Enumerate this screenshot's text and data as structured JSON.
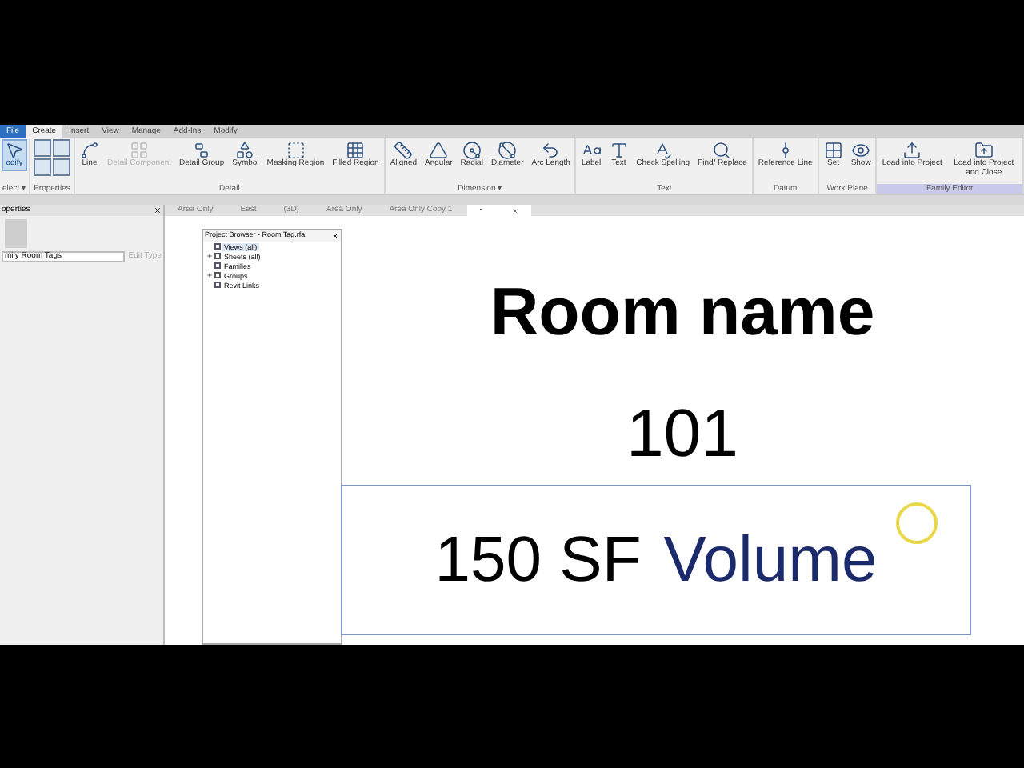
{
  "menu_tabs": [
    {
      "label": "File",
      "kind": "file",
      "selected": false
    },
    {
      "label": "Create",
      "kind": "tab",
      "selected": true
    },
    {
      "label": "Insert",
      "kind": "tab",
      "selected": false
    },
    {
      "label": "View",
      "kind": "tab",
      "selected": false
    },
    {
      "label": "Manage",
      "kind": "tab",
      "selected": false
    },
    {
      "label": "Add-Ins",
      "kind": "tab",
      "selected": false
    },
    {
      "label": "Modify",
      "kind": "tab",
      "selected": false
    }
  ],
  "ribbon_panels": [
    {
      "label": "elect ▾",
      "highlighted": false,
      "tools": [
        {
          "label": "odify",
          "kind": "large",
          "selected": true,
          "disabled": false
        }
      ]
    },
    {
      "label": "Properties",
      "highlighted": false,
      "tools": [
        {
          "kind": "stack"
        }
      ]
    },
    {
      "label": "Detail",
      "highlighted": false,
      "tools": [
        {
          "label": "Line",
          "kind": "large",
          "selected": false,
          "disabled": false
        },
        {
          "label": "Detail Component",
          "kind": "large",
          "selected": false,
          "disabled": true
        },
        {
          "label": "Detail Group",
          "kind": "large",
          "selected": false,
          "disabled": false
        },
        {
          "label": "Symbol",
          "kind": "large",
          "selected": false,
          "disabled": false
        },
        {
          "label": "Masking Region",
          "kind": "large",
          "selected": false,
          "disabled": false
        },
        {
          "label": "Filled Region",
          "kind": "large",
          "selected": false,
          "disabled": false
        }
      ]
    },
    {
      "label": "Dimension ▾",
      "highlighted": false,
      "tools": [
        {
          "label": "Aligned",
          "kind": "large",
          "selected": false,
          "disabled": false
        },
        {
          "label": "Angular",
          "kind": "large",
          "selected": false,
          "disabled": false
        },
        {
          "label": "Radial",
          "kind": "large",
          "selected": false,
          "disabled": false
        },
        {
          "label": "Diameter",
          "kind": "large",
          "selected": false,
          "disabled": false
        },
        {
          "label": "Arc Length",
          "kind": "large",
          "selected": false,
          "disabled": false
        }
      ]
    },
    {
      "label": "Text",
      "highlighted": false,
      "tools": [
        {
          "label": "Label",
          "kind": "large",
          "selected": false,
          "disabled": false
        },
        {
          "label": "Text",
          "kind": "large",
          "selected": false,
          "disabled": false
        },
        {
          "label": "Check Spelling",
          "kind": "large",
          "selected": false,
          "disabled": false
        },
        {
          "label": "Find/ Replace",
          "kind": "large",
          "selected": false,
          "disabled": false
        }
      ]
    },
    {
      "label": "Datum",
      "highlighted": false,
      "tools": [
        {
          "label": "Reference Line",
          "kind": "large",
          "selected": false,
          "disabled": false
        }
      ]
    },
    {
      "label": "Work Plane",
      "highlighted": false,
      "tools": [
        {
          "label": "Set",
          "kind": "large",
          "selected": false,
          "disabled": false
        },
        {
          "label": "Show",
          "kind": "large",
          "selected": false,
          "disabled": false
        }
      ]
    },
    {
      "label": "Family Editor",
      "highlighted": true,
      "tools": [
        {
          "label": "Load into Project",
          "kind": "large",
          "selected": false,
          "disabled": false
        },
        {
          "label": "Load into Project and Close",
          "kind": "large",
          "selected": false,
          "disabled": false
        }
      ]
    }
  ],
  "properties": {
    "title": "operties",
    "type": "mily Room Tags",
    "edit_type": {
      "label": "Edit Type",
      "disabled": true
    }
  },
  "view_tabs": [
    {
      "label": "Area Only",
      "selected": false
    },
    {
      "label": "East",
      "selected": false
    },
    {
      "label": "(3D)",
      "selected": false
    },
    {
      "label": "Area Only",
      "selected": false
    },
    {
      "label": "Area Only Copy 1",
      "selected": false
    },
    {
      "label": "-",
      "selected": true
    }
  ],
  "project_browser": {
    "title": "Project Browser - Room Tag.rfa",
    "items": [
      {
        "label": "Views (all)",
        "expandable": false,
        "selected": true
      },
      {
        "label": "Sheets (all)",
        "expandable": true,
        "selected": false
      },
      {
        "label": "Families",
        "expandable": false,
        "selected": false
      },
      {
        "label": "Groups",
        "expandable": true,
        "selected": false
      },
      {
        "label": "Revit Links",
        "expandable": false,
        "selected": false
      }
    ]
  },
  "canvas": {
    "title": "Room name",
    "number": "101",
    "area": "150 SF",
    "volume": "Volume"
  }
}
